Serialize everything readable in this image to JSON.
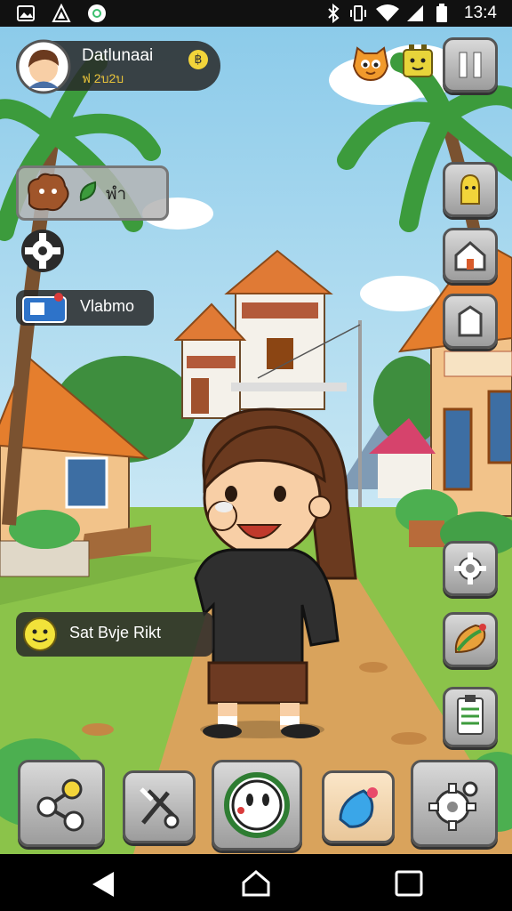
{
  "status_bar": {
    "time": "13:4",
    "icons": [
      "gallery-icon",
      "app-icon",
      "chrome-icon",
      "bluetooth-icon",
      "vibrate-icon",
      "wifi-icon",
      "signal-icon",
      "battery-icon"
    ]
  },
  "player": {
    "name": "Datlunaai",
    "sub": "ฟ 2บ2บ",
    "coin_glyph": "฿"
  },
  "top_buttons": [
    "pet-face-icon",
    "battery-face-icon",
    "pause-icon"
  ],
  "pet_panel": {
    "text": "พำ"
  },
  "location_panel": {
    "label": "Vlabmo"
  },
  "chat_panel": {
    "label": "Sat Bvje Rikt"
  },
  "colors": {
    "sky": "#9fd3ee",
    "grass": "#8bc34a",
    "path": "#d9a35c",
    "panel": "#2b2b2b",
    "button_gray": "#bdbdbd"
  }
}
